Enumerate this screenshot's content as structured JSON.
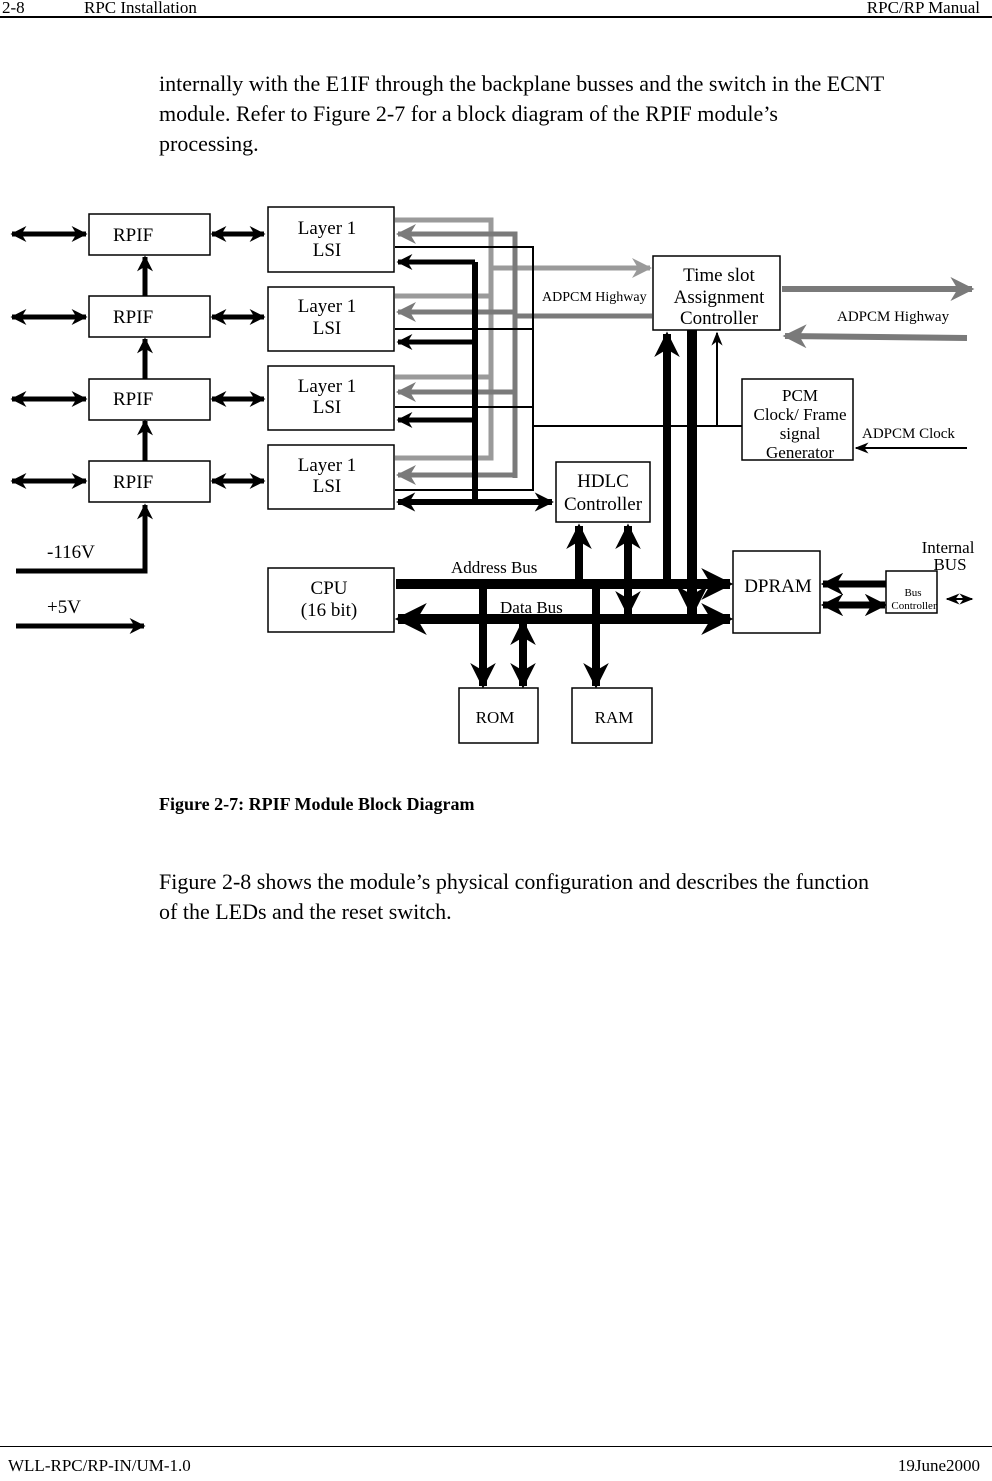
{
  "header": {
    "page_number": "2-8",
    "section": "RPC Installation",
    "manual": "RPC/RP Manual"
  },
  "intro_paragraph": {
    "lines": [
      "internally with the E1IF through the backplane busses and the switch in the ECNT",
      "module.  Refer to Figure 2-7 for a block diagram of the RPIF module’s",
      "processing."
    ]
  },
  "diagram": {
    "colors": {
      "black": "#000000",
      "light_gray": "#9a9a9a",
      "dark_gray": "#7a7a7a",
      "background": "#ffffff"
    },
    "rpif_blocks": [
      {
        "label": "RPIF"
      },
      {
        "label": "RPIF"
      },
      {
        "label": "RPIF"
      },
      {
        "label": "RPIF"
      }
    ],
    "layer1_blocks": [
      {
        "line1": "Layer 1",
        "line2": "LSI"
      },
      {
        "line1": "Layer 1",
        "line2": "LSI"
      },
      {
        "line1": "Layer 1",
        "line2": "LSI"
      },
      {
        "line1": "Layer 1",
        "line2": "LSI"
      }
    ],
    "time_slot_controller": {
      "line1": "Time slot",
      "line2": "Assignment",
      "line3": "Controller"
    },
    "pcm_generator": {
      "line1": "PCM",
      "line2": "Clock/ Frame",
      "line3": "signal",
      "line4": "Generator"
    },
    "hdlc_controller": {
      "line1": "HDLC",
      "line2": "Controller"
    },
    "cpu": {
      "line1": "CPU",
      "line2": "(16 bit)"
    },
    "dpram": {
      "label": "DPRAM"
    },
    "rom": {
      "label": "ROM"
    },
    "ram": {
      "label": "RAM"
    },
    "bus_controller": {
      "line1": "Bus",
      "line2": "Controller"
    },
    "labels": {
      "adpcm_highway_left": "ADPCM Highway",
      "adpcm_highway_right": "ADPCM Highway",
      "adpcm_clock": "ADPCM Clock",
      "internal_bus_line1": "Internal",
      "internal_bus_line2": "BUS",
      "address_bus": "Address Bus",
      "data_bus": "Data Bus",
      "voltage_minus": "-116V",
      "voltage_plus": "+5V"
    }
  },
  "caption": "Figure 2-7: RPIF Module Block Diagram",
  "follow_paragraph": {
    "lines": [
      "Figure 2-8 shows the module’s physical configuration and describes the function",
      "of the LEDs and the reset switch."
    ]
  },
  "footer": {
    "doc_id": "WLL-RPC/RP-IN/UM-1.0",
    "date": "19June2000"
  }
}
